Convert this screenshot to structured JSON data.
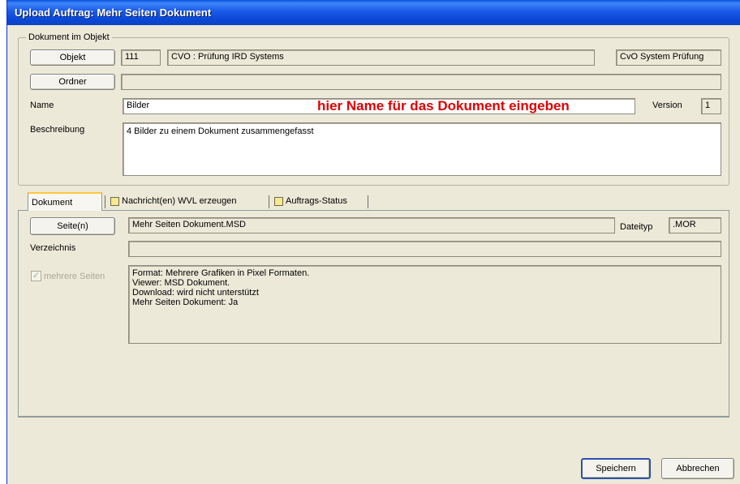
{
  "window": {
    "title": "Upload Auftrag: Mehr Seiten Dokument"
  },
  "group": {
    "legend": "Dokument im Objekt",
    "objekt_button": "Objekt",
    "objekt_id": "111",
    "objekt_name": "CVO : Prüfung IRD Systems",
    "objekt_type": "CvO System Prüfung",
    "ordner_button": "Ordner",
    "ordner_value": "",
    "name_label": "Name",
    "name_value": "Bilder",
    "name_hint": "hier Name für das Dokument eingeben",
    "version_label": "Version",
    "version_value": "1",
    "beschreibung_label": "Beschreibung",
    "beschreibung_value": "4 Bilder zu einem Dokument zusammengefasst"
  },
  "tabs": [
    {
      "label": "Dokument"
    },
    {
      "label": "Nachricht(en) WVL erzeugen"
    },
    {
      "label": "Auftrags-Status"
    }
  ],
  "dokument_tab": {
    "seiten_button": "Seite(n)",
    "seiten_value": "Mehr Seiten Dokument.MSD",
    "dateityp_label": "Dateityp",
    "dateityp_value": ".MOR",
    "verzeichnis_label": "Verzeichnis",
    "verzeichnis_value": "",
    "mehrere_seiten_label": "mehrere Seiten",
    "mehrere_seiten_checked": true,
    "info_lines": [
      "Format: Mehrere Grafiken in Pixel Formaten.",
      "Viewer: MSD Dokument.",
      "Download: wird nicht unterstützt",
      "Mehr Seiten Dokument: Ja"
    ]
  },
  "footer": {
    "save_button": "Speichern",
    "cancel_button": "Abbrechen"
  },
  "colors": {
    "titlebar": "#0a47d3",
    "hint": "#e00000",
    "window_bg": "#ece9d8"
  }
}
